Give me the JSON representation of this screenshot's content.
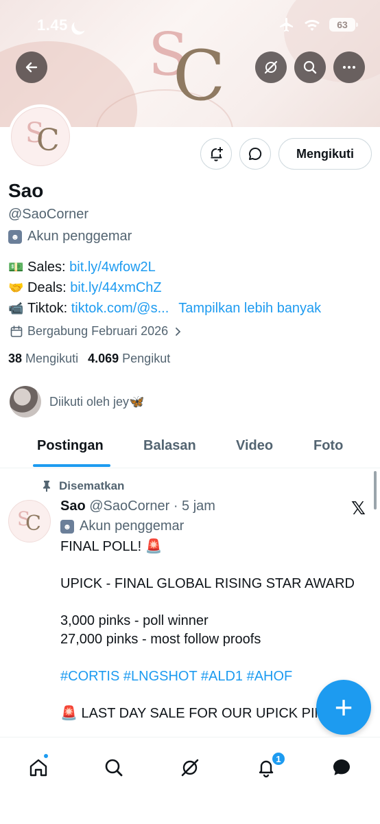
{
  "status_bar": {
    "time": "1.45",
    "battery": "63"
  },
  "banner": {
    "logo_s": "S",
    "logo_c": "C"
  },
  "profile": {
    "name": "Sao",
    "handle": "@SaoCorner",
    "fan_label": "Akun penggemar",
    "follow_button": "Mengikuti",
    "bio": [
      {
        "emoji": "💵",
        "label": "Sales: ",
        "link": "bit.ly/4wfow2L",
        "more": ""
      },
      {
        "emoji": "🤝",
        "label": "Deals: ",
        "link": "bit.ly/44xmChZ",
        "more": ""
      },
      {
        "emoji": "📹",
        "label": "Tiktok: ",
        "link": "tiktok.com/@s...",
        "more": "Tampilkan lebih banyak"
      }
    ],
    "joined": "Bergabung Februari 2026",
    "following_count": "38",
    "following_label": "Mengikuti",
    "followers_count": "4.069",
    "followers_label": "Pengikut",
    "followed_by": "Diikuti oleh jey🦋"
  },
  "tabs": [
    {
      "label": "Postingan",
      "active": true
    },
    {
      "label": "Balasan",
      "active": false
    },
    {
      "label": "Video",
      "active": false
    },
    {
      "label": "Foto",
      "active": false
    }
  ],
  "post": {
    "pinned_label": "Disematkan",
    "author_name": "Sao",
    "author_meta": " @SaoCorner · 5 jam",
    "fan_label": "Akun penggemar",
    "lines": [
      "FINAL POLL! 🚨",
      "",
      "UPICK - FINAL GLOBAL RISING STAR AWARD",
      "",
      "3,000 pinks - poll winner",
      "27,000 pinks - most follow proofs",
      "",
      "#CORTIS #LNGSHOT #ALD1 #AHOF",
      "",
      "🚨 LAST DAY SALE FOR OUR UPICK PINKS"
    ]
  },
  "fab_label": "+",
  "bottom_nav": {
    "notification_badge": "1",
    "items": [
      "home-icon",
      "search-icon",
      "grok-icon",
      "notifications-icon",
      "messages-icon"
    ]
  },
  "colors": {
    "accent": "#1d9bf0",
    "text": "#0f1419",
    "muted": "#536471"
  }
}
